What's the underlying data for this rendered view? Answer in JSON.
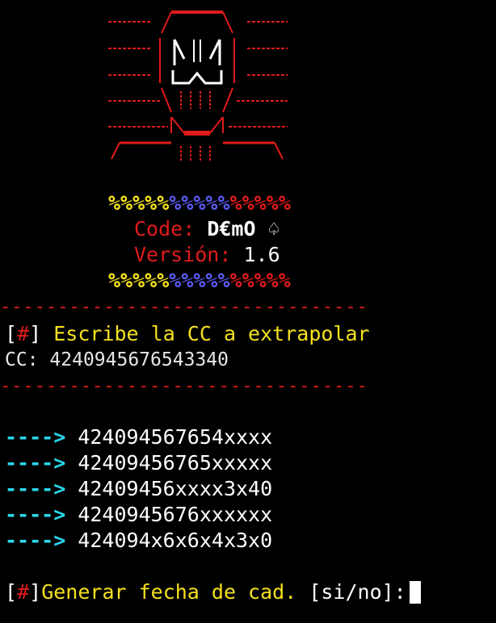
{
  "banner": {
    "percent_yellow": "%%%%%",
    "percent_blue": "%%%%%",
    "percent_red": "%%%%%",
    "code_label": "Code:",
    "code_value": "D€mO ♤",
    "version_label": "Versión:",
    "version_value": "1.6"
  },
  "separator": "--------------------------------",
  "prompt": {
    "marker_open": "[",
    "marker_hash": "#",
    "marker_close": "]",
    "text": " Escribe la CC a extrapolar",
    "cc_label": "CC:",
    "cc_value": "4240945676543340"
  },
  "arrow": "---->",
  "results": [
    "424094567654xxxx",
    "42409456765xxxxx",
    "42409456xxxx3x40",
    "4240945676xxxxxx",
    "424094x6x6x4x3x0"
  ],
  "question": {
    "marker_open": "[",
    "marker_hash": "#",
    "marker_close": "]",
    "text": "Generar fecha de cad.",
    "options": "[si/no]:"
  },
  "colors": {
    "red": "#e01b1b",
    "yellow": "#f5e11e",
    "blue": "#5a5af0",
    "cyan": "#2ad7e8",
    "white": "#ffffff"
  }
}
